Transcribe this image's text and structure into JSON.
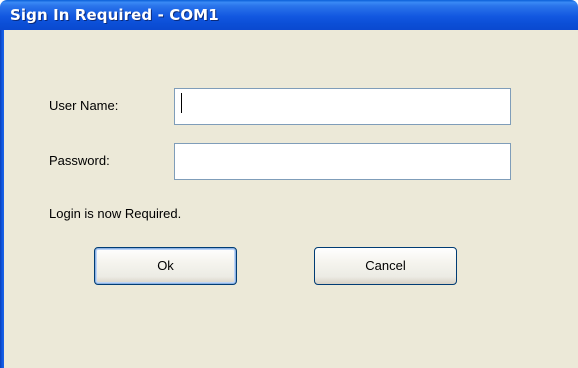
{
  "window": {
    "title": "Sign In Required - COM1"
  },
  "form": {
    "username_label": "User Name:",
    "username_value": "",
    "password_label": "Password:",
    "password_value": "",
    "status_message": "Login is now Required."
  },
  "buttons": {
    "ok_label": "Ok",
    "cancel_label": "Cancel"
  },
  "colors": {
    "titlebar": "#0a4fd6",
    "client_background": "#ece9d8",
    "textbox_border": "#7f9db9",
    "button_border": "#003c74"
  }
}
